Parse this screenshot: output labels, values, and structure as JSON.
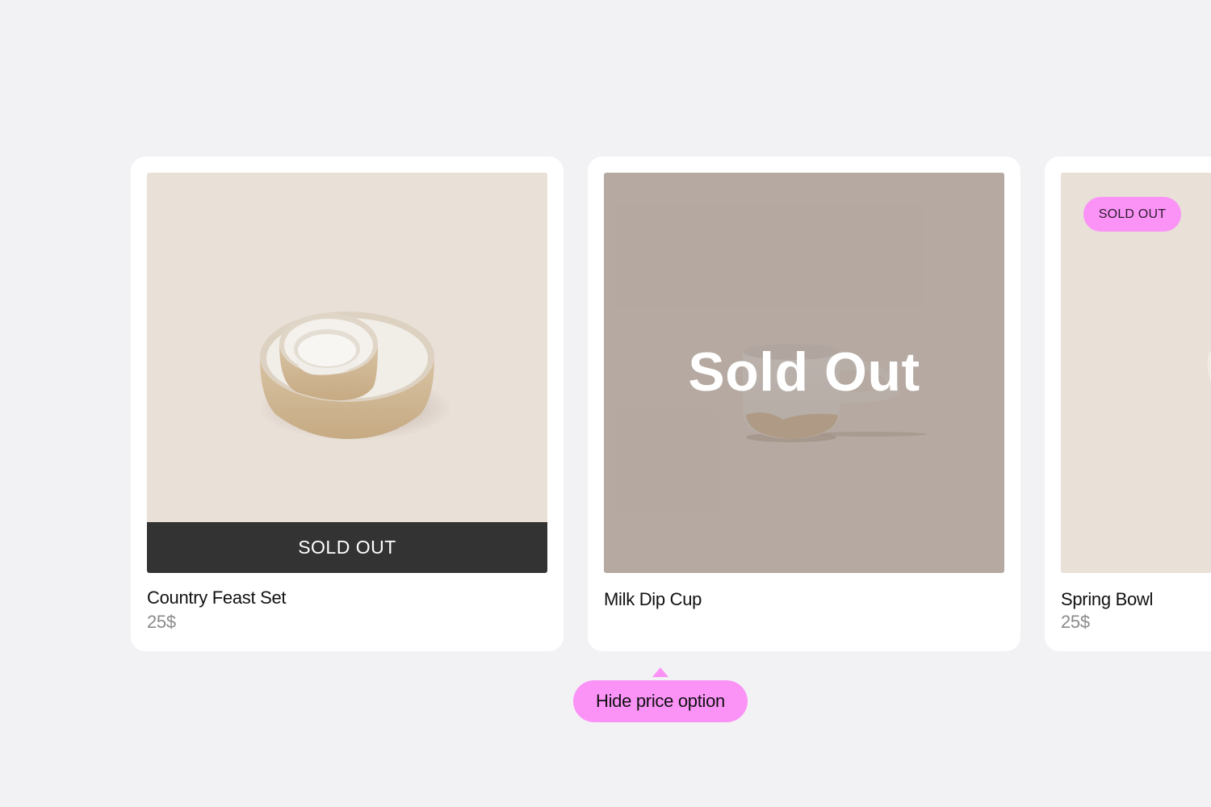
{
  "products": [
    {
      "name": "Country Feast Set",
      "price": "25$",
      "badge": "SOLD OUT",
      "image_icon": "nested-bowls-icon"
    },
    {
      "name": "Milk Dip Cup",
      "overlay": "Sold Out",
      "image_icon": "cup-icon"
    },
    {
      "name": "Spring Bowl",
      "price": "25$",
      "badge": "SOLD OUT",
      "image_icon": "bowl-icon"
    }
  ],
  "tooltip": {
    "label": "Hide price option"
  },
  "colors": {
    "background": "#f2f2f4",
    "card": "#ffffff",
    "image_bg": "#e9e0d8",
    "soldout_bar": "#333333",
    "pink_accent": "#fb93f7",
    "price_text": "#8a8a8a"
  }
}
